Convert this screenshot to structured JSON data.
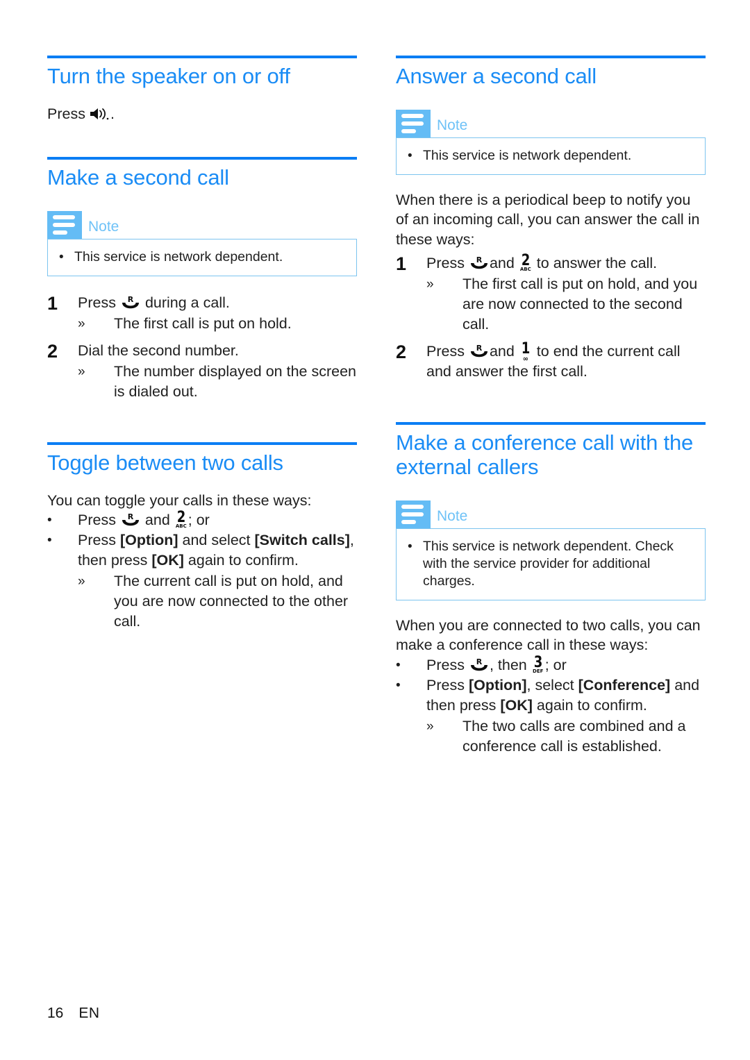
{
  "colors": {
    "heading_blue": "#1a8cf5",
    "rule_blue": "#0b7ef4",
    "note_icon_blue": "#64bcf5",
    "note_label_blue": "#6fc2f7",
    "note_border_blue": "#7cc4ef",
    "body_text": "#1f1f1f"
  },
  "left_column": {
    "section_speaker": {
      "title": "Turn the speaker on or off",
      "press_prefix": "Press",
      "press_suffix": ".",
      "icon": "speaker-icon"
    },
    "section_make_second_call": {
      "title": "Make a second call",
      "note": {
        "label": "Note",
        "icon": "note-lines-icon",
        "items": [
          "This service is network dependent."
        ]
      },
      "steps": [
        {
          "number": "1",
          "text_before": "Press",
          "icon": "recall-key-icon",
          "text_after": "during a call.",
          "results": [
            "The first call is put on hold."
          ]
        },
        {
          "number": "2",
          "text_before": "Dial the second number.",
          "icon": "",
          "text_after": "",
          "results": [
            "The number displayed on the screen is dialed out."
          ]
        }
      ]
    },
    "section_toggle": {
      "title": "Toggle between two calls",
      "intro": "You can toggle your calls in these ways:",
      "bullets": [
        {
          "parts": [
            "Press",
            " and ",
            "; or"
          ],
          "icons": [
            "recall-key-icon",
            "key-2-abc-icon"
          ]
        },
        {
          "text_1": "Press ",
          "bold_1": "[Option]",
          "text_2": " and select ",
          "bold_2": "[Switch calls]",
          "text_3": ", then press ",
          "bold_3": "[OK]",
          "text_4": " again to confirm."
        }
      ],
      "result": "The current call is put on hold, and you are now connected to the other call."
    }
  },
  "right_column": {
    "section_answer_second": {
      "title": "Answer a second call",
      "note": {
        "label": "Note",
        "icon": "note-lines-icon",
        "items": [
          "This service is network dependent."
        ]
      },
      "intro": "When there is a periodical beep to notify you of an incoming call, you can answer the call in these ways:",
      "steps": [
        {
          "number": "1",
          "text_before": "Press",
          "icon_1": "recall-key-icon",
          "text_mid": "and",
          "icon_2": "key-2-abc-icon",
          "text_after": "to answer the call.",
          "results": [
            "The first call is put on hold, and you are now connected to the second call."
          ]
        },
        {
          "number": "2",
          "text_before": "Press",
          "icon_1": "recall-key-icon",
          "text_mid": "and",
          "icon_2": "key-1-icon",
          "text_after": "to end the current call and answer the first call.",
          "results": []
        }
      ]
    },
    "section_conference": {
      "title": "Make a conference call with the external callers",
      "note": {
        "label": "Note",
        "icon": "note-lines-icon",
        "items": [
          "This service is network dependent. Check with the service provider for additional charges."
        ]
      },
      "intro": "When you are connected to two calls, you can make a conference call in these ways:",
      "bullets": [
        {
          "text_1": "Press",
          "icon_1": "recall-key-icon",
          "text_2": ", then",
          "icon_2": "key-3-def-icon",
          "text_3": "; or"
        },
        {
          "text_1": "Press ",
          "bold_1": "[Option]",
          "text_2": ", select ",
          "bold_2": "[Conference]",
          "text_3": " and then press ",
          "bold_3": "[OK]",
          "text_4": " again to confirm."
        }
      ],
      "result": "The two calls are combined and a conference call is established."
    }
  },
  "keys": {
    "recall": {
      "letter": "R"
    },
    "key2": {
      "digit": "2",
      "letters": "ABC"
    },
    "key1": {
      "digit": "1",
      "letters": "∞"
    },
    "key3": {
      "digit": "3",
      "letters": "DEF"
    }
  },
  "markers": {
    "bullet": "•",
    "result_arrow": "»"
  },
  "footer": {
    "page_number": "16",
    "language": "EN"
  }
}
